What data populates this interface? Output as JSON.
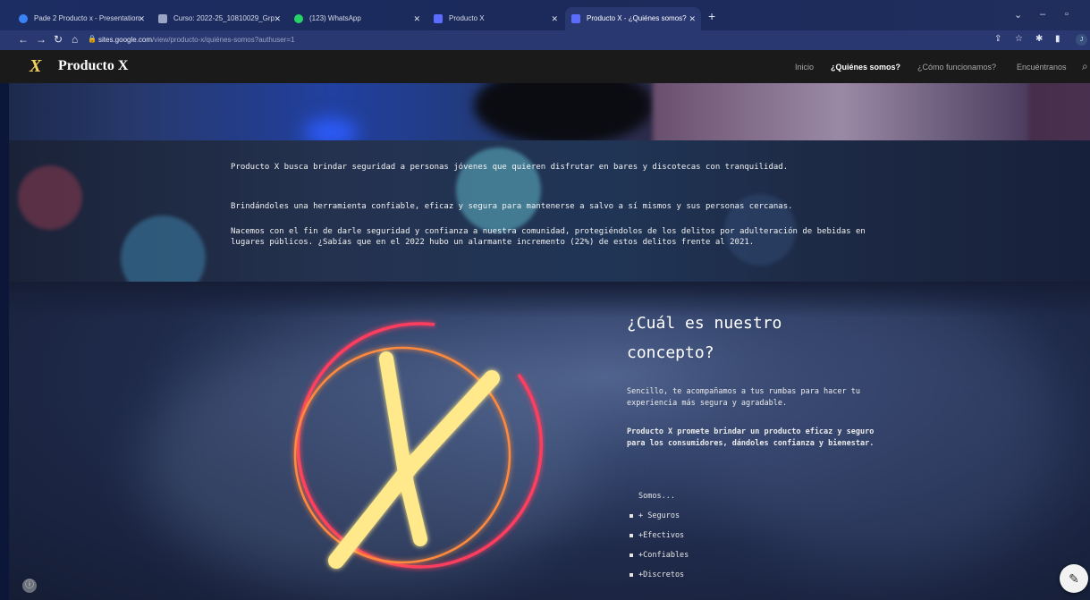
{
  "browser": {
    "tabs": [
      {
        "title": "Pade 2 Producto x - Presentation",
        "favicon_color": "#3b82f6"
      },
      {
        "title": "Curso: 2022-25_10810029_Grp",
        "favicon_color": "#9aa4c4"
      },
      {
        "title": "(123) WhatsApp",
        "favicon_color": "#25d366"
      },
      {
        "title": "Producto X",
        "favicon_color": "#5b6cff"
      },
      {
        "title": "Producto X - ¿Quiénes somos?",
        "favicon_color": "#5b6cff"
      }
    ],
    "url_host": "sites.google.com",
    "url_path": "/view/producto-x/quiénes-somos?authuser=1",
    "profile_initial": "J"
  },
  "site": {
    "logo_mark": "X",
    "brand": "Producto X",
    "nav": [
      {
        "label": "Inicio",
        "active": false
      },
      {
        "label": "¿Quiénes somos?",
        "active": true
      },
      {
        "label": "¿Cómo funcionamos?",
        "active": false
      },
      {
        "label": "Encuéntranos",
        "active": false
      }
    ]
  },
  "intro": {
    "p1": "Producto X busca brindar seguridad a personas jóvenes que quieren disfrutar en bares y discotecas con tranquilidad.",
    "p2": "Brindándoles una herramienta confiable, eficaz y segura para mantenerse a salvo a sí mismos y sus personas cercanas.",
    "p3": "Nacemos con el fin de darle seguridad y confianza a nuestra comunidad, protegiéndolos de los delitos por adulteración de bebidas en lugares públicos. ¿Sabías que en el 2022 hubo un alarmante incremento (22%) de estos delitos frente al 2021."
  },
  "concept": {
    "title": "¿Cuál es nuestro concepto?",
    "p1": "Sencillo, te acompañamos a tus rumbas para hacer tu experiencia más segura y agradable.",
    "p2": "Producto X promete brindar un producto eficaz y seguro para los consumidores, dándoles confianza y bienestar.",
    "somos": "Somos...",
    "items": [
      "+ Seguros",
      "+Efectivos",
      "+Confiables",
      "+Discretos"
    ],
    "emblem_letter": "X"
  },
  "colors": {
    "neon_yellow": "#ffe98a",
    "neon_ring_outer": "#ff3d5e",
    "neon_ring_inner": "#ff8a3d"
  }
}
